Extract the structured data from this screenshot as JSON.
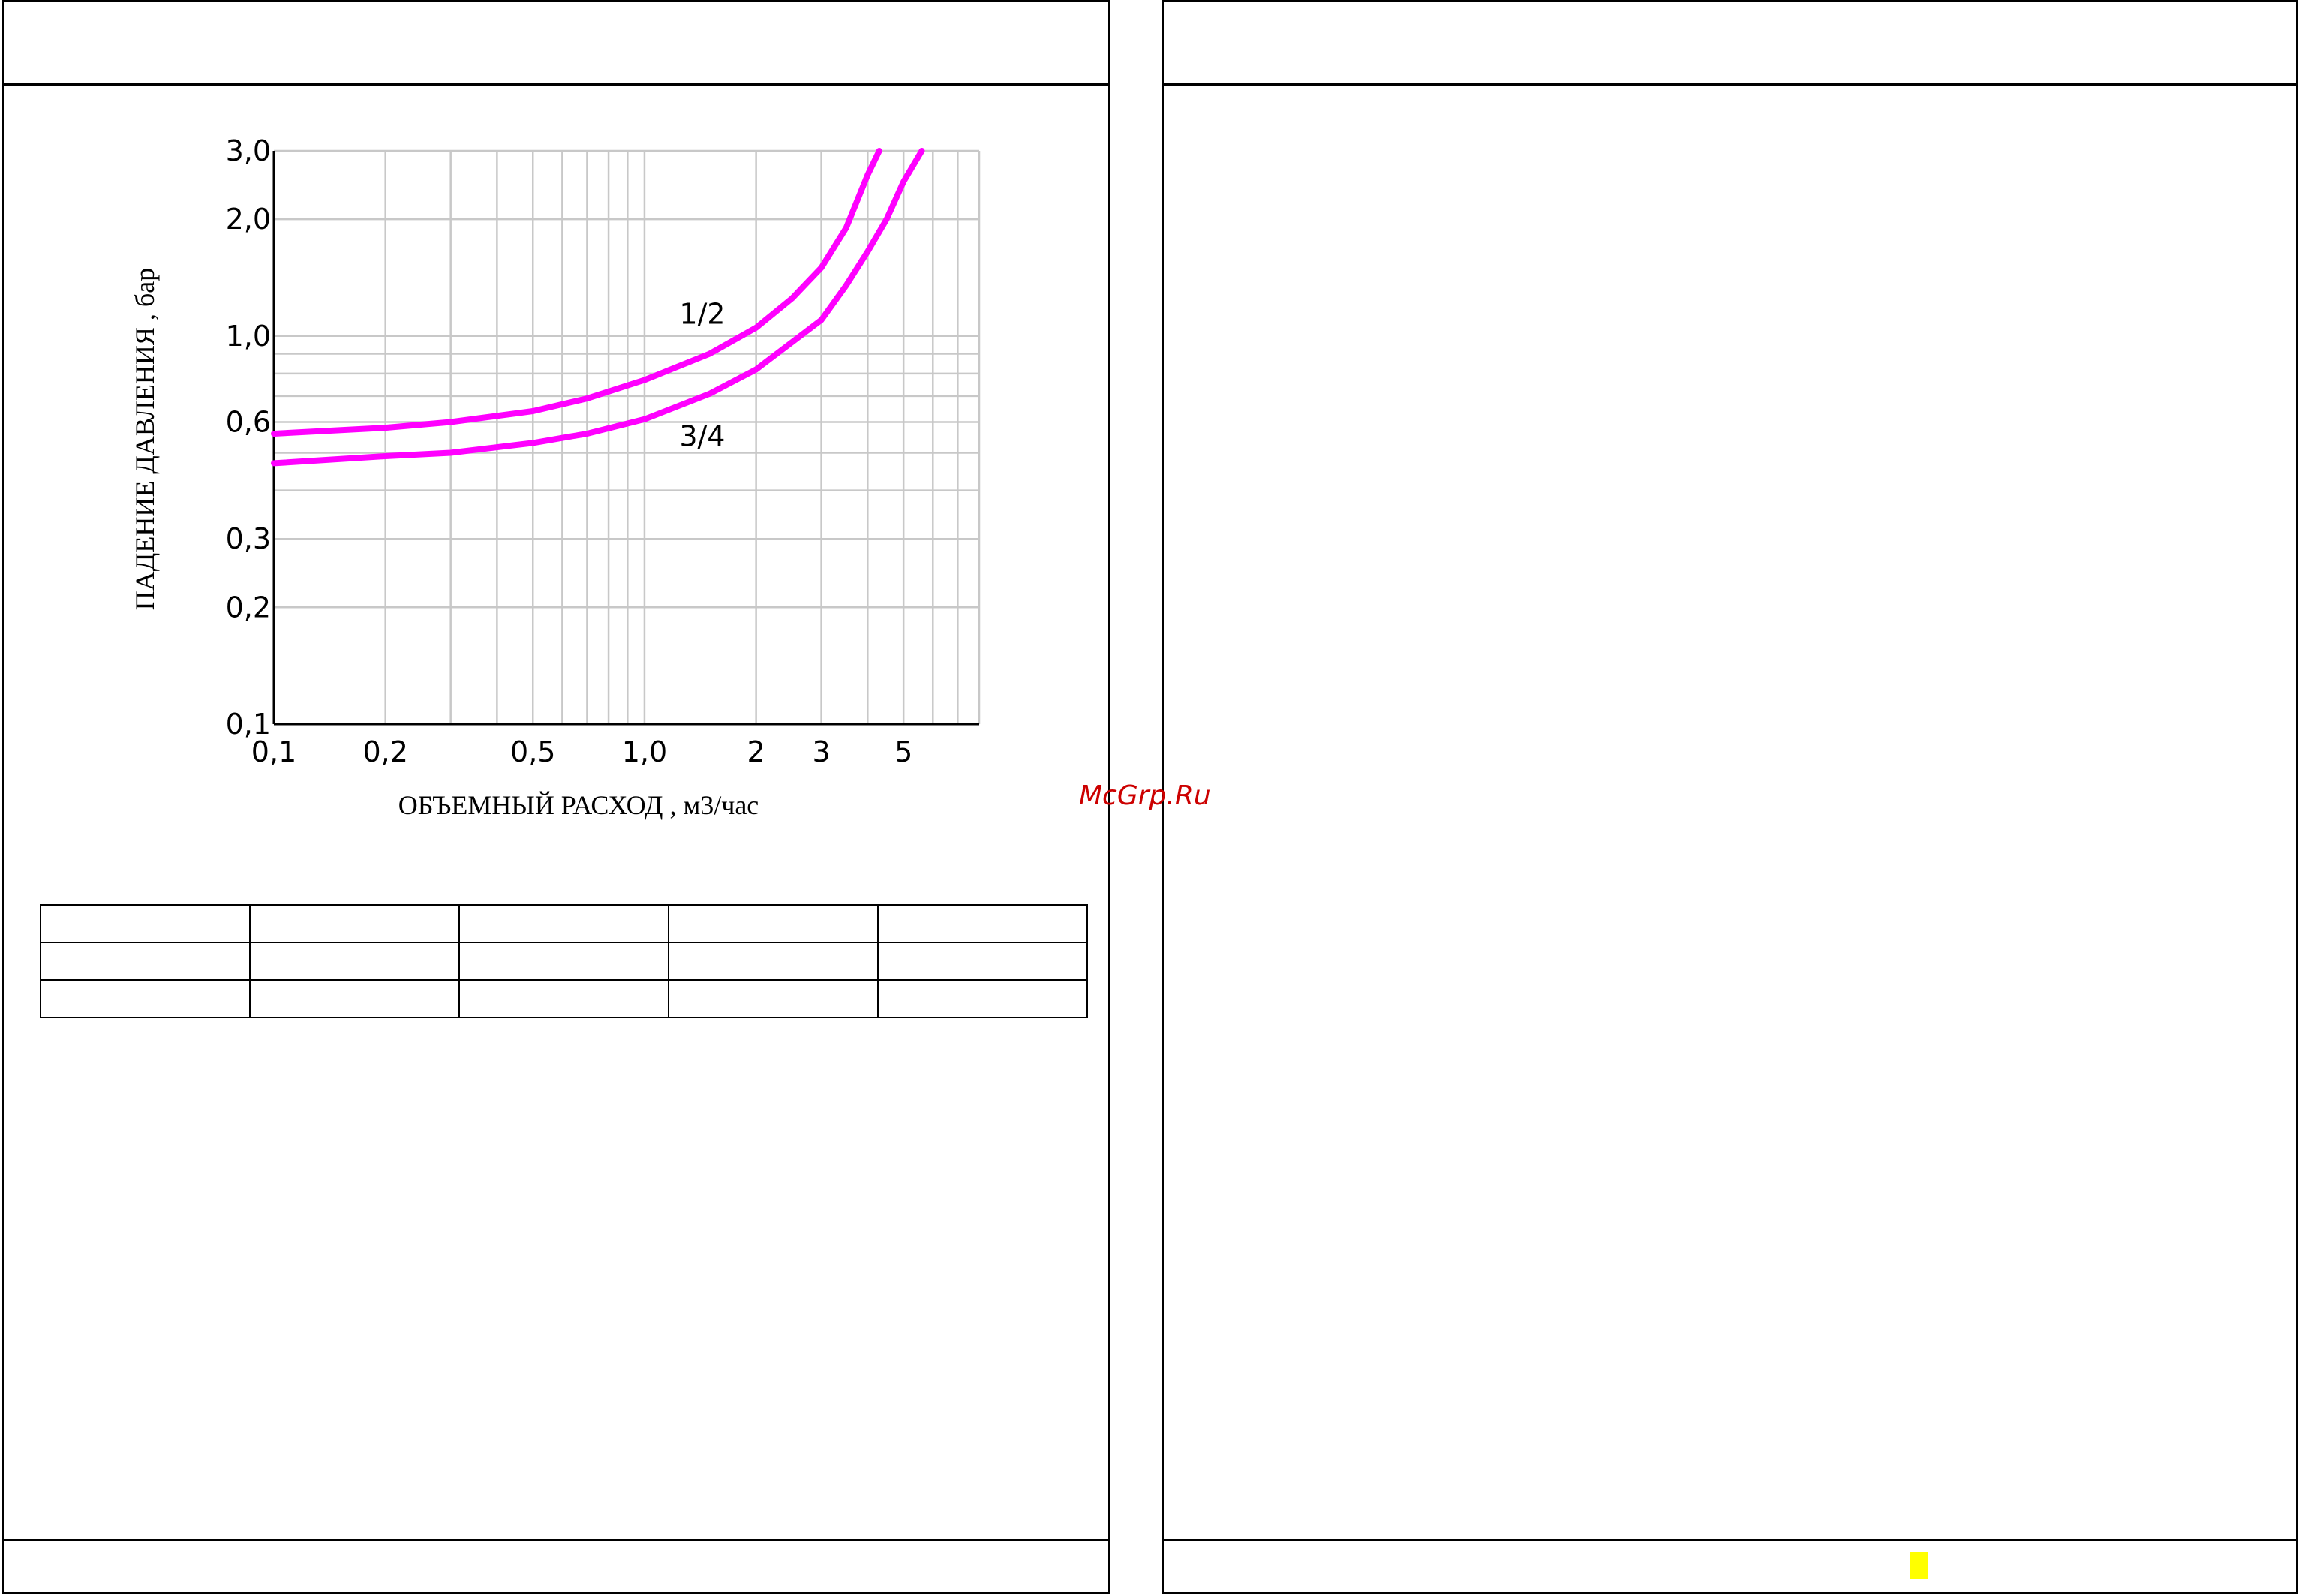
{
  "watermark": "McGrp.Ru",
  "colors": {
    "curve": "#ff00ff",
    "grid": "#c8c8c8",
    "axis": "#000000",
    "marker": "#ffff00"
  },
  "chart_data": {
    "type": "line",
    "xscale": "log",
    "yscale": "log",
    "xlim": [
      0.1,
      8
    ],
    "ylim": [
      0.1,
      3.0
    ],
    "xlabel": "ОБЪЕМНЫЙ РАСХОД , м3/час",
    "ylabel": "ПАДЕНИЕ ДАВЛЕНИЯ , бар",
    "x_ticks": [
      {
        "value": 0.1,
        "label": "0,1"
      },
      {
        "value": 0.2,
        "label": "0,2"
      },
      {
        "value": 0.5,
        "label": "0,5"
      },
      {
        "value": 1.0,
        "label": "1,0"
      },
      {
        "value": 2,
        "label": "2"
      },
      {
        "value": 3,
        "label": "3"
      },
      {
        "value": 5,
        "label": "5"
      }
    ],
    "y_ticks": [
      {
        "value": 0.1,
        "label": "0,1"
      },
      {
        "value": 0.2,
        "label": "0,2"
      },
      {
        "value": 0.3,
        "label": "0,3"
      },
      {
        "value": 0.6,
        "label": "0,6"
      },
      {
        "value": 1.0,
        "label": "1,0"
      },
      {
        "value": 2.0,
        "label": "2,0"
      },
      {
        "value": 3.0,
        "label": "3,0"
      }
    ],
    "x_grid": [
      0.1,
      0.2,
      0.3,
      0.4,
      0.5,
      0.6,
      0.7,
      0.8,
      0.9,
      1.0,
      2,
      3,
      4,
      5,
      6,
      7,
      8
    ],
    "y_grid": [
      0.1,
      0.2,
      0.3,
      0.4,
      0.5,
      0.6,
      0.7,
      0.8,
      0.9,
      1.0,
      2.0,
      3.0
    ],
    "grid": true,
    "series": [
      {
        "name": "1/2",
        "x": [
          0.1,
          0.2,
          0.3,
          0.5,
          0.7,
          1.0,
          1.5,
          2.0,
          2.5,
          3.0,
          3.5,
          4.0,
          4.3
        ],
        "y": [
          0.56,
          0.58,
          0.6,
          0.64,
          0.69,
          0.77,
          0.9,
          1.05,
          1.25,
          1.5,
          1.9,
          2.6,
          3.0
        ]
      },
      {
        "name": "3/4",
        "x": [
          0.1,
          0.2,
          0.3,
          0.5,
          0.7,
          1.0,
          1.5,
          2.0,
          3.0,
          3.5,
          4.0,
          4.5,
          5.0,
          5.6
        ],
        "y": [
          0.47,
          0.49,
          0.5,
          0.53,
          0.56,
          0.61,
          0.71,
          0.82,
          1.1,
          1.35,
          1.65,
          2.0,
          2.5,
          3.0
        ]
      }
    ]
  }
}
